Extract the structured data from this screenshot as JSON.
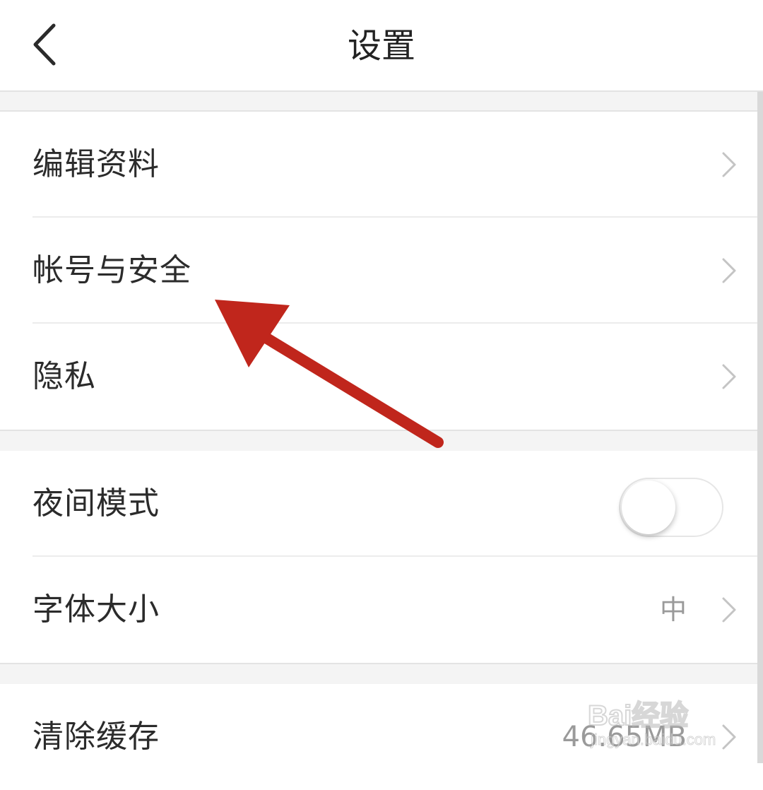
{
  "header": {
    "title": "设置",
    "back_icon": "chevron-left-icon"
  },
  "groups": [
    {
      "items": [
        {
          "label": "编辑资料",
          "control": "chevron"
        },
        {
          "label": "帐号与安全",
          "control": "chevron"
        },
        {
          "label": "隐私",
          "control": "chevron"
        }
      ]
    },
    {
      "items": [
        {
          "label": "夜间模式",
          "control": "toggle",
          "toggle_on": false
        },
        {
          "label": "字体大小",
          "value": "中",
          "control": "chevron"
        }
      ]
    },
    {
      "items": [
        {
          "label": "清除缓存",
          "value": "46.65MB",
          "control": "chevron"
        }
      ]
    }
  ],
  "annotation": {
    "type": "arrow",
    "color": "#c0261c",
    "points_to": "帐号与安全"
  },
  "watermark": {
    "logo": "Bai经验",
    "url": "jingyan.baidu.com"
  },
  "colors": {
    "background": "#ffffff",
    "section_gap": "#f4f4f4",
    "text_primary": "#2b2b2b",
    "text_secondary": "#9a9a9a",
    "chevron": "#c4c4c4"
  }
}
